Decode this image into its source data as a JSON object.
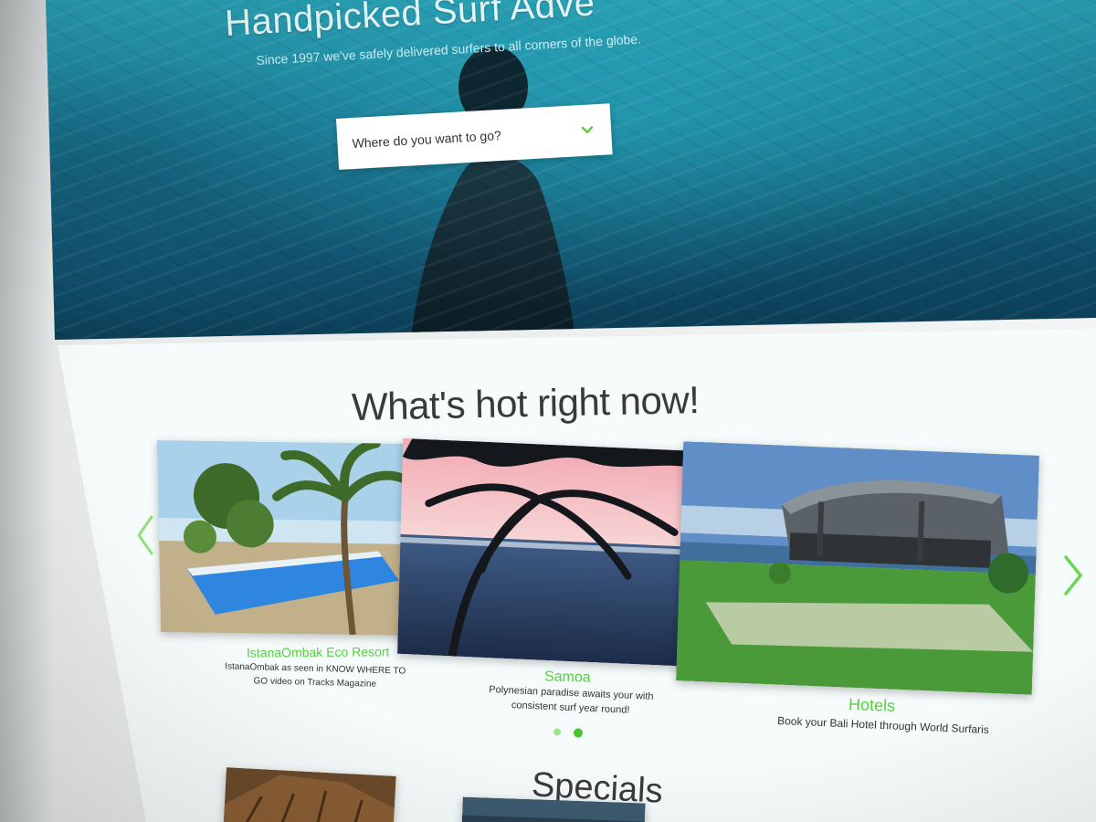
{
  "hero": {
    "title": "Handpicked Surf Adve",
    "subtitle": "Since 1997 we've safely delivered surfers to all corners of the globe.",
    "search": {
      "placeholder": "Where do you want to go?",
      "icon": "chevron-down-icon"
    }
  },
  "hot": {
    "title": "What's hot right now!",
    "cards": [
      {
        "title": "IstanaOmbak Eco Resort",
        "description": "IstanaOmbak as seen in KNOW WHERE TO GO video on Tracks Magazine"
      },
      {
        "title": "Samoa",
        "description": "Polynesian paradise awaits your with consistent surf year round!"
      },
      {
        "title": "Hotels",
        "description": "Book your Bali Hotel through World Surfaris"
      }
    ],
    "carousel": {
      "prev_icon": "chevron-left-icon",
      "next_icon": "chevron-right-icon",
      "dot_count": 2,
      "active_dot": 2
    }
  },
  "specials": {
    "title": "Specials"
  },
  "colors": {
    "accent_green": "#55d13c",
    "hero_blue": "#1b7f98",
    "text_dark": "#3a3a3a"
  }
}
